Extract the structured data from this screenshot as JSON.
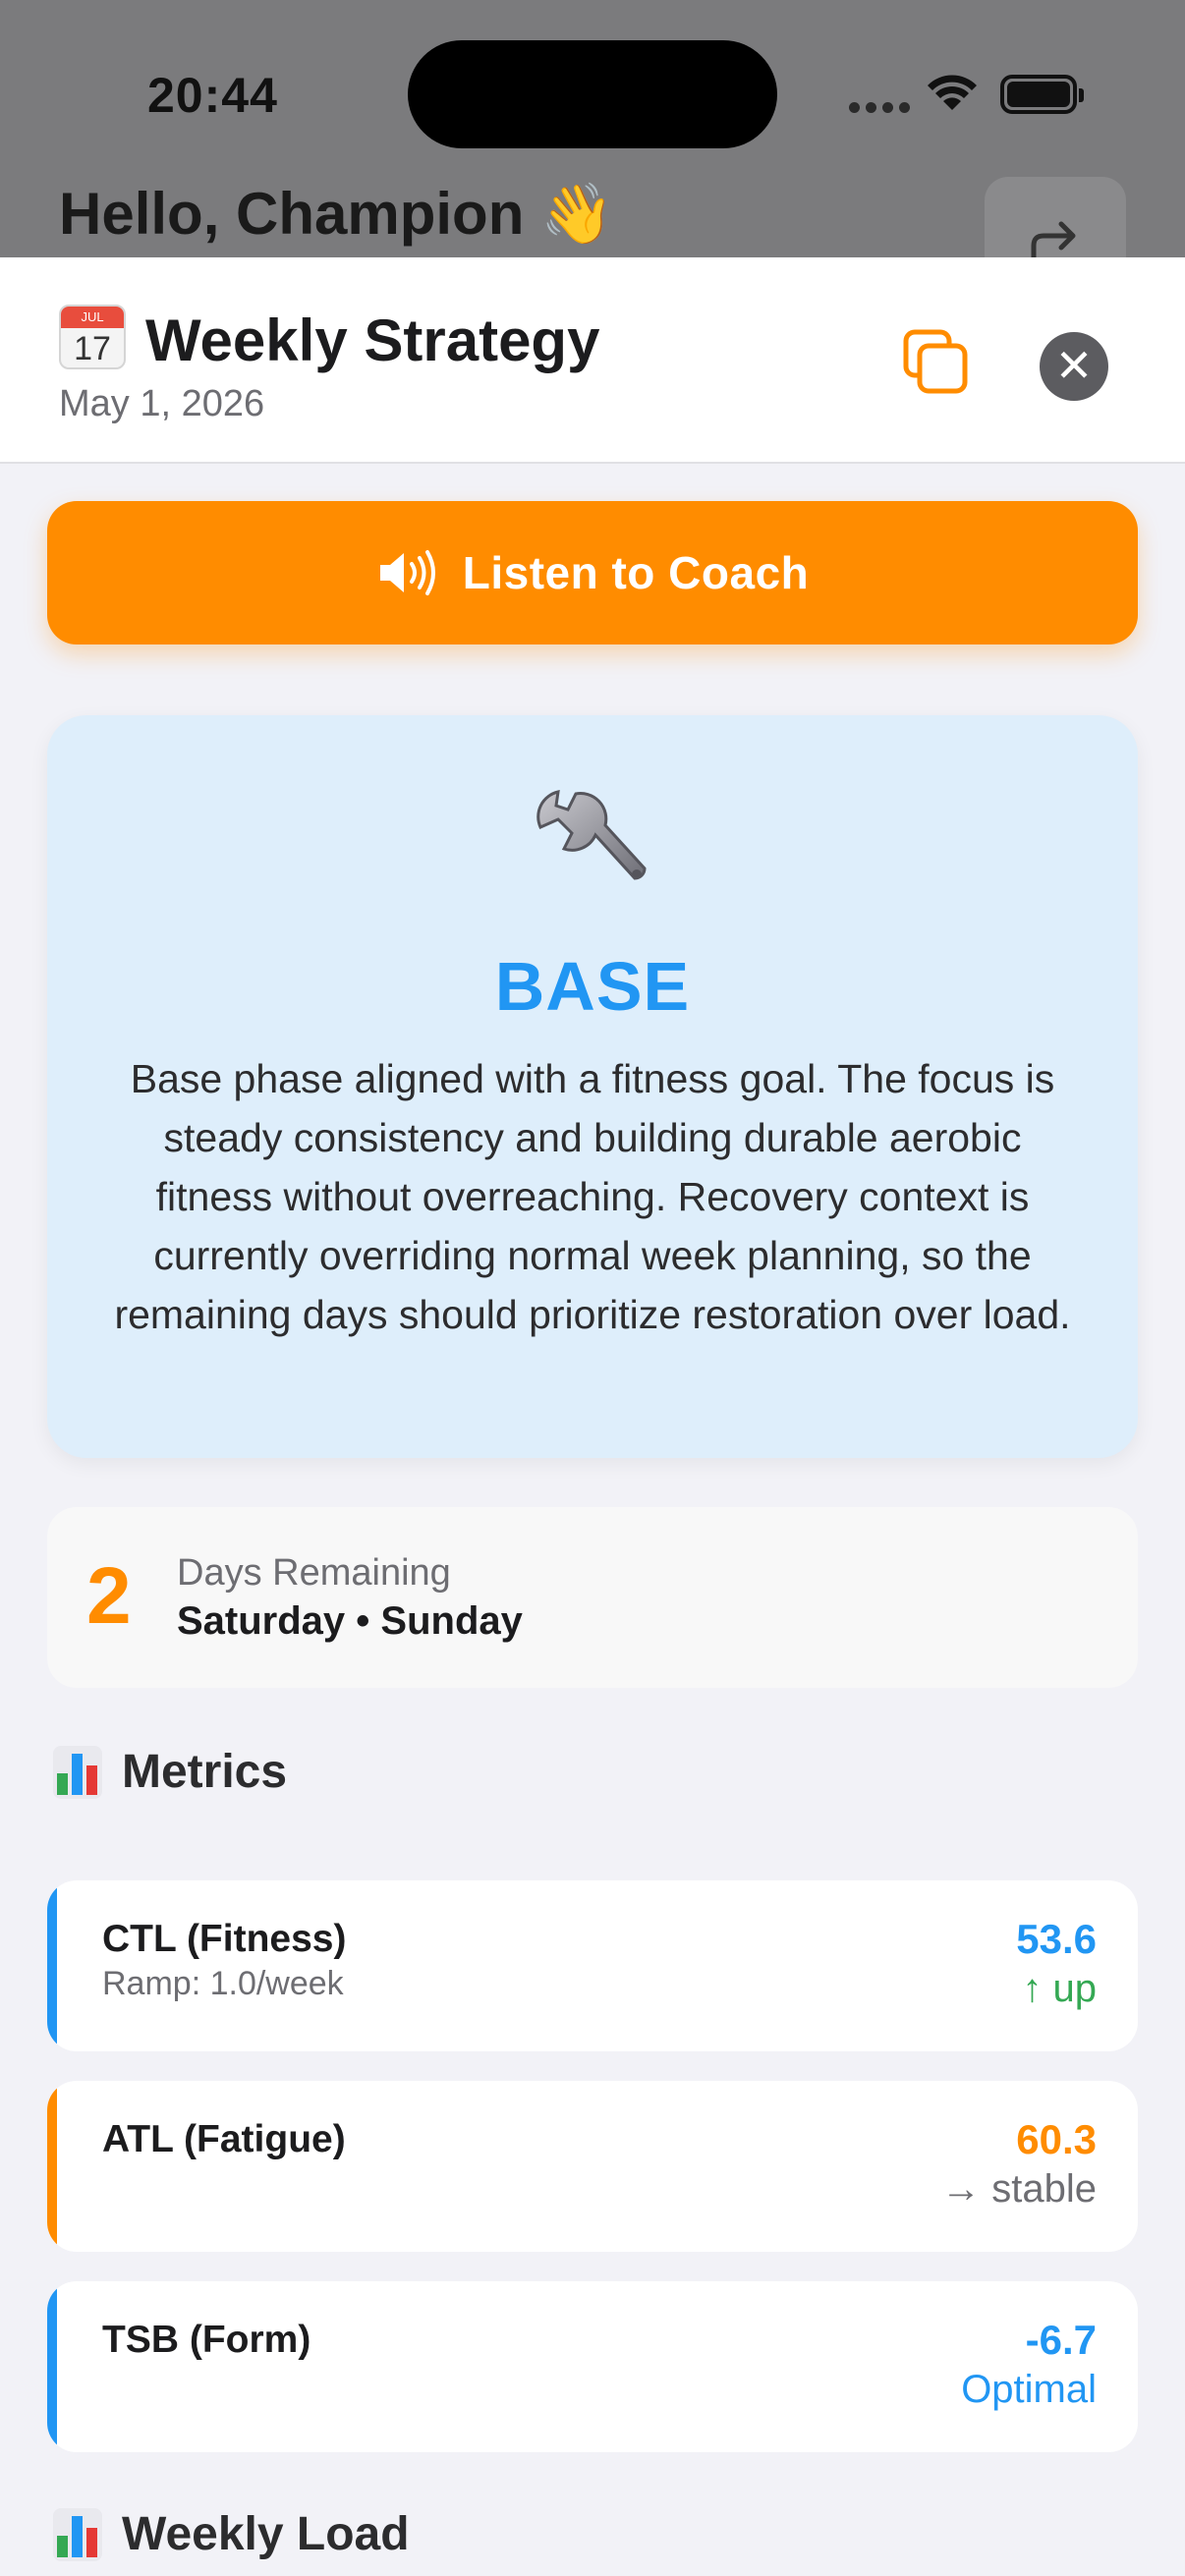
{
  "status_bar": {
    "time": "20:44"
  },
  "background_screen": {
    "greeting": "Hello, Champion 👋"
  },
  "sheet": {
    "title": "Weekly Strategy",
    "date": "May 1, 2026",
    "calendar_icon": {
      "month": "JUL",
      "day": "17"
    }
  },
  "listen_button": {
    "label": "Listen to Coach",
    "icon": "speaker-icon"
  },
  "phase": {
    "icon": "wrench-icon",
    "name": "BASE",
    "description": "Base phase aligned with a fitness goal. The focus is steady consistency and building durable aerobic fitness without overreaching. Recovery context is currently overriding normal week planning, so the remaining days should prioritize restoration over load."
  },
  "days_remaining": {
    "count": "2",
    "label": "Days Remaining",
    "days": "Saturday • Sunday"
  },
  "metrics_section": {
    "title": "Metrics"
  },
  "metrics": [
    {
      "name": "CTL (Fitness)",
      "sub": "Ramp: 1.0/week",
      "value": "53.6",
      "trend": "↑ up",
      "accent": "#2196f3",
      "value_color": "#2196f3",
      "trend_color": "#34a853"
    },
    {
      "name": "ATL (Fatigue)",
      "sub": "",
      "value": "60.3",
      "trend": "→ stable",
      "accent": "#ff8c00",
      "value_color": "#ff8c00",
      "trend_color": "#6d6d72"
    },
    {
      "name": "TSB (Form)",
      "sub": "",
      "value": "-6.7",
      "trend": "Optimal",
      "accent": "#2196f3",
      "value_color": "#2196f3",
      "trend_color": "#2196f3"
    }
  ],
  "weekly_load_section": {
    "title": "Weekly Load"
  },
  "colors": {
    "accent_orange": "#ff8c00",
    "accent_blue": "#2196f3",
    "phase_bg": "#deeefb"
  }
}
